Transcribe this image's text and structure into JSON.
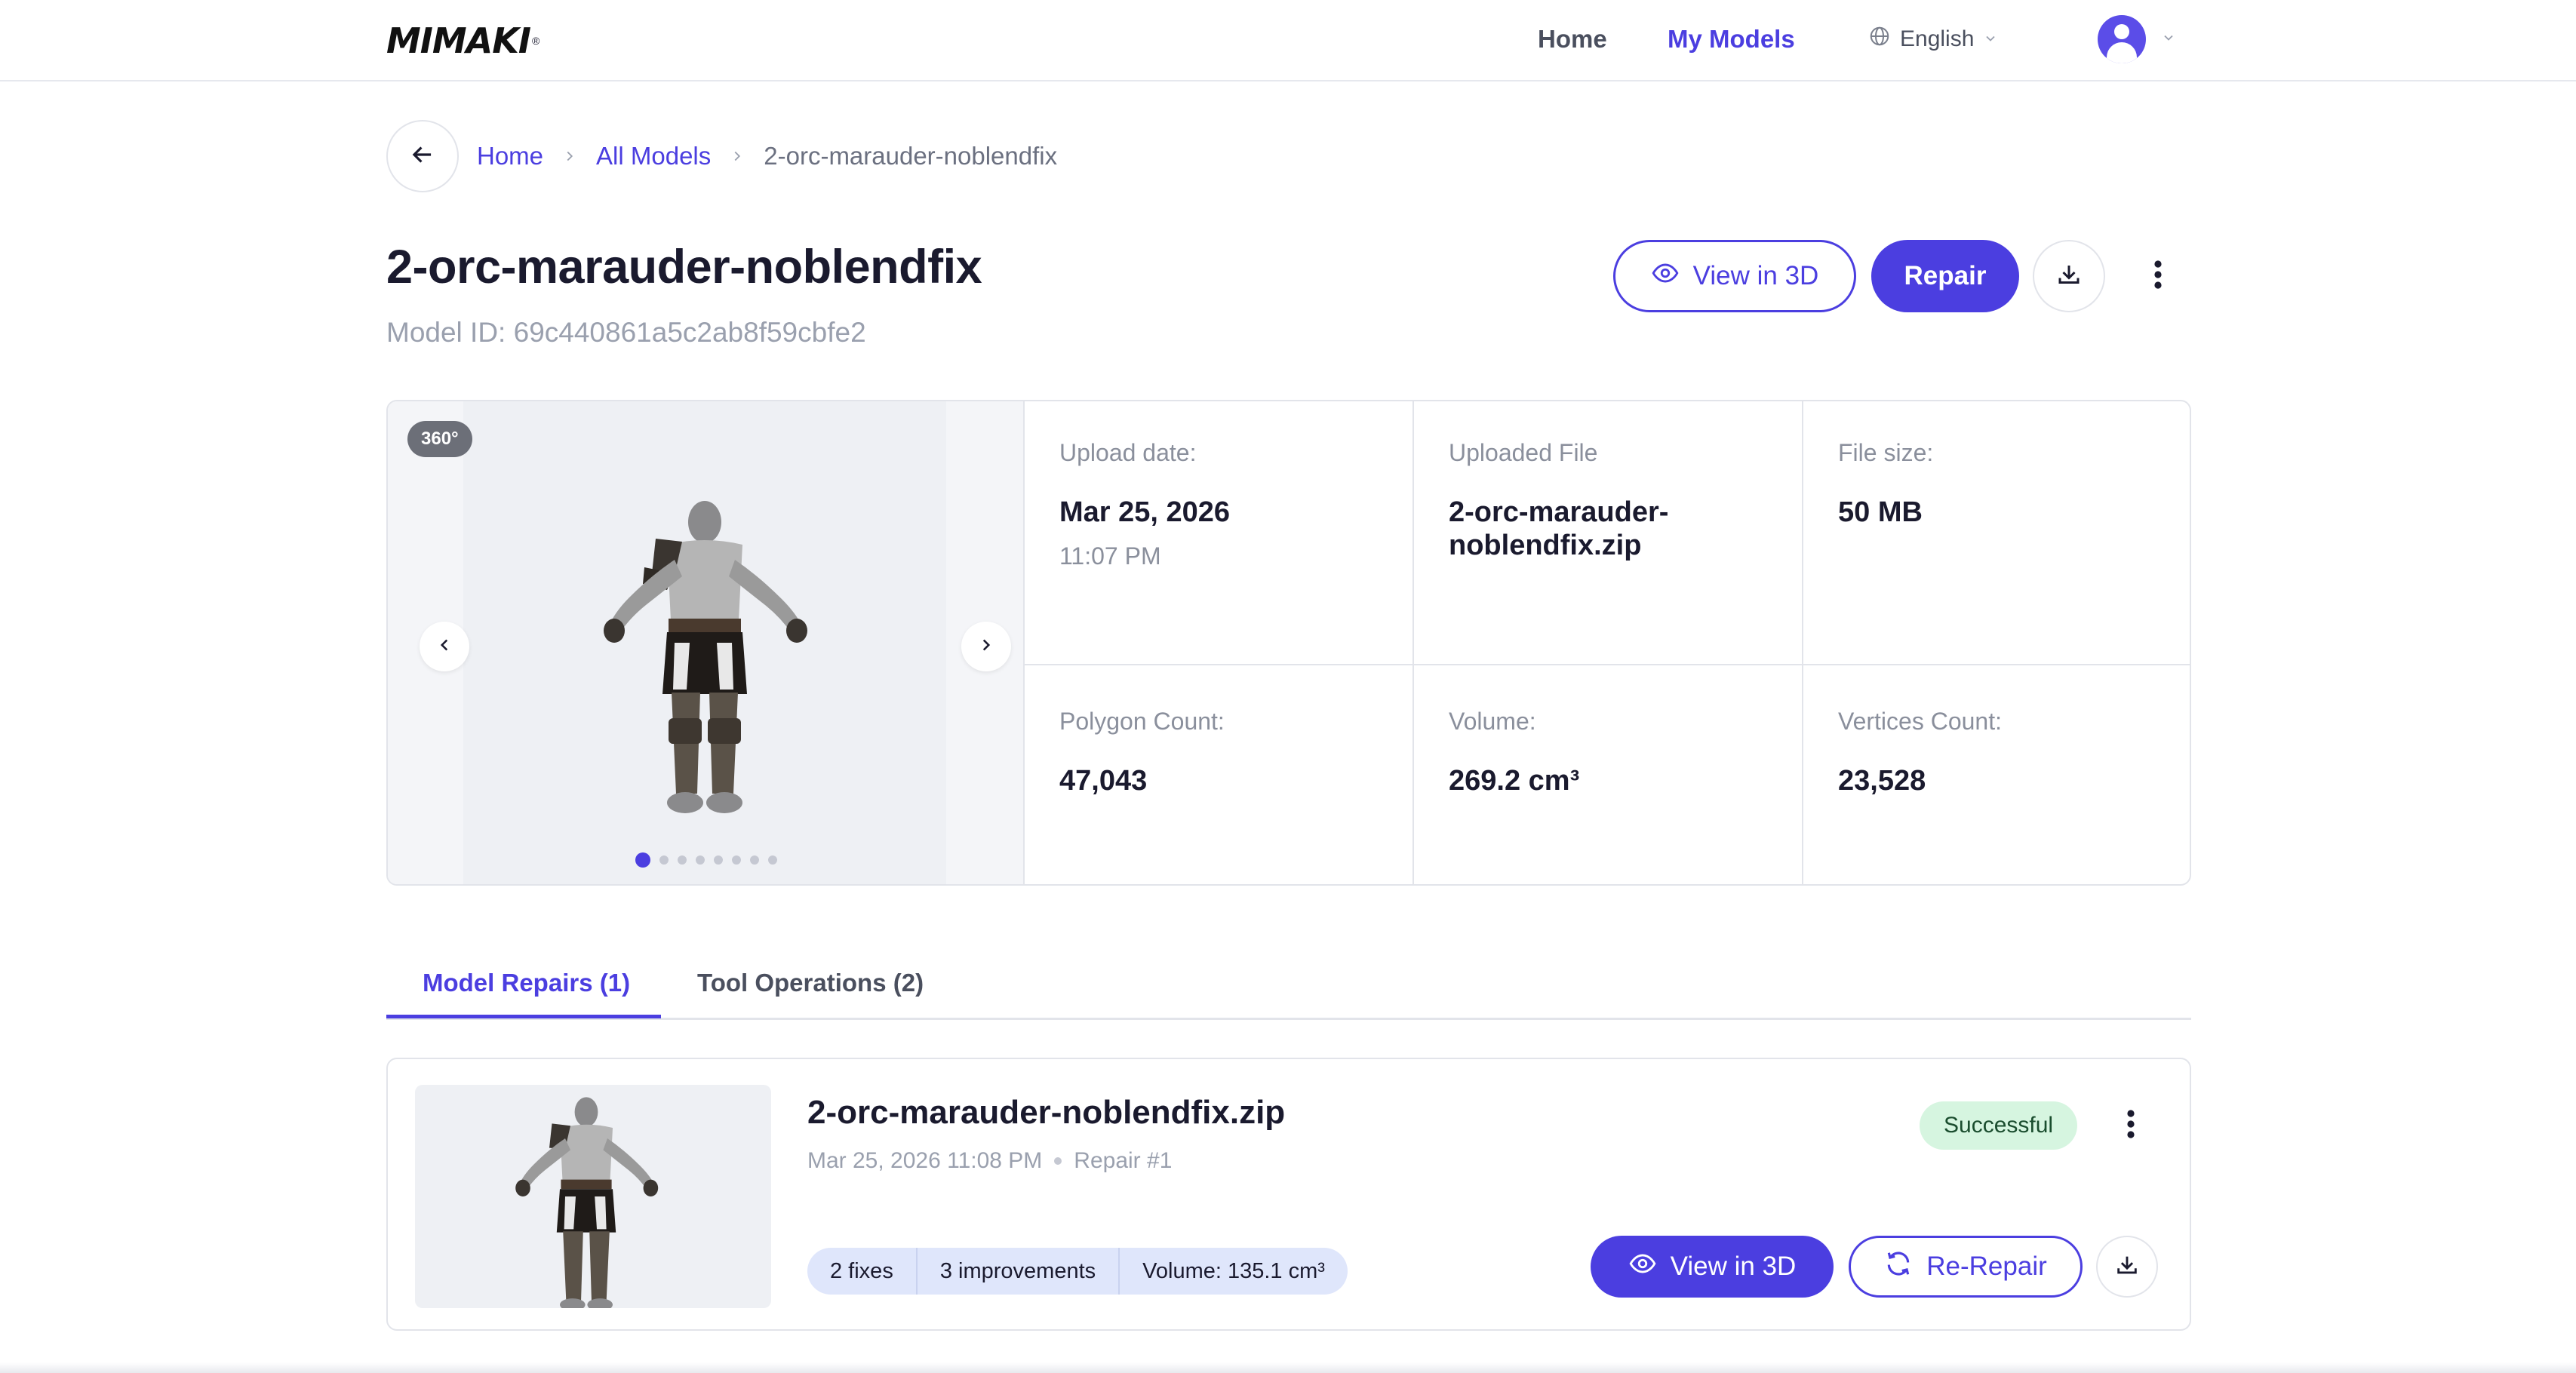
{
  "brand": {
    "logo_text": "MIMAKI",
    "accent_color": "#4b3ee0"
  },
  "nav": {
    "home_label": "Home",
    "my_models_label": "My Models",
    "language_label": "English"
  },
  "breadcrumb": {
    "home": "Home",
    "all_models": "All Models",
    "current": "2-orc-marauder-noblendfix"
  },
  "model": {
    "title": "2-orc-marauder-noblendfix",
    "id_text": "Model ID: 69c440861a5c2ab8f59cbfe2"
  },
  "actions": {
    "view3d_label": "View in 3D",
    "repair_label": "Repair"
  },
  "viewer": {
    "badge": "360°",
    "slide_count": 8,
    "active_slide": 1
  },
  "info": {
    "upload_date_label": "Upload date:",
    "upload_date": "Mar 25, 2026",
    "upload_time": "11:07 PM",
    "uploaded_file_label": "Uploaded File",
    "uploaded_file": "2-orc-marauder-noblendfix.zip",
    "file_size_label": "File size:",
    "file_size": "50 MB",
    "polygon_label": "Polygon Count:",
    "polygon_value": "47,043",
    "volume_label": "Volume:",
    "volume_value": "269.2 cm³",
    "vertices_label": "Vertices Count:",
    "vertices_value": "23,528"
  },
  "tabs": {
    "repairs": "Model Repairs (1)",
    "operations": "Tool Operations (2)",
    "active": "repairs"
  },
  "repair": {
    "title": "2-orc-marauder-noblendfix.zip",
    "date": "Mar 25, 2026 11:08 PM",
    "number": "Repair #1",
    "status": "Successful",
    "status_color": "#d6f5e0",
    "chips": [
      "2 fixes",
      "3 improvements",
      "Volume: 135.1 cm³"
    ],
    "view3d_label": "View in 3D",
    "rerepair_label": "Re-Repair"
  }
}
